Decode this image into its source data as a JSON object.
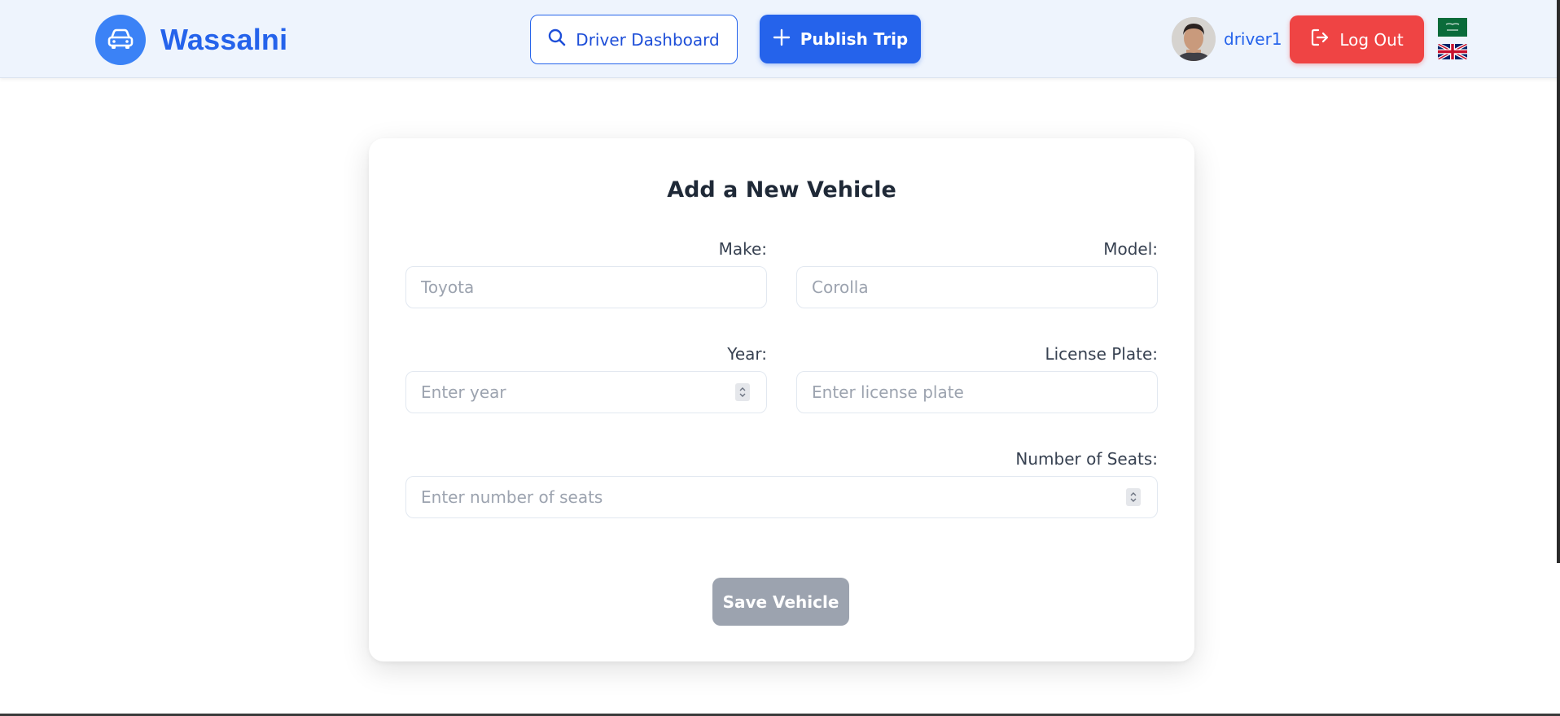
{
  "brand": {
    "name": "Wassalni",
    "logo_icon": "car-icon",
    "accent": "#2563eb"
  },
  "nav": {
    "dashboard_label": "Driver Dashboard",
    "dashboard_icon": "search-icon",
    "publish_label": "Publish Trip",
    "publish_icon": "plus-icon",
    "username": "driver1",
    "logout_label": "Log Out",
    "logout_icon": "logout-icon",
    "languages": [
      "ar",
      "en"
    ]
  },
  "form": {
    "title": "Add a New Vehicle",
    "make": {
      "label": "Make:",
      "placeholder": "Toyota"
    },
    "model": {
      "label": "Model:",
      "placeholder": "Corolla"
    },
    "year": {
      "label": "Year:",
      "placeholder": "Enter year"
    },
    "plate": {
      "label": "License Plate:",
      "placeholder": "Enter license plate"
    },
    "seats": {
      "label": "Number of Seats:",
      "placeholder": "Enter number of seats"
    },
    "save_label": "Save Vehicle"
  },
  "colors": {
    "primary": "#2563eb",
    "danger": "#ef4444",
    "disabled": "#9ca3af",
    "navbar_bg": "#eef4fd"
  }
}
